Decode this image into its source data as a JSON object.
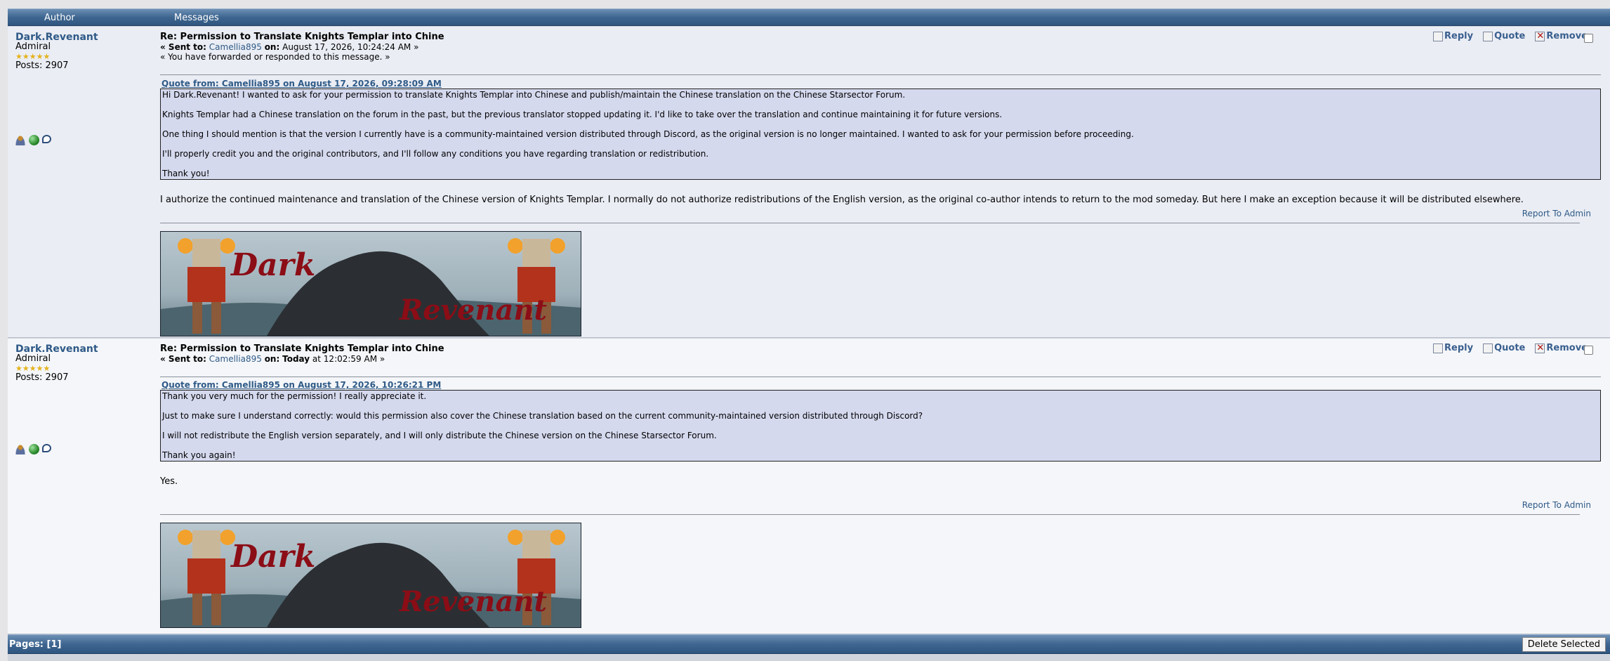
{
  "header": {
    "author_col": "Author",
    "messages_col": "Messages"
  },
  "posts": [
    {
      "author": {
        "name": "Dark.Revenant",
        "rank": "Admiral",
        "stars": "★★★★★",
        "posts": "Posts: 2907"
      },
      "subject": "Re: Permission to Translate Knights Templar into Chine",
      "sent_to_label": "« Sent to:",
      "sent_to_user": "Camellia895",
      "on_label": "on:",
      "date": "August 17, 2026, 10:24:24 AM »",
      "note": "« You have forwarded or responded to this message. »",
      "actions": {
        "reply": "Reply",
        "quote": "Quote",
        "remove": "Remove"
      },
      "quote_header": "Quote from: Camellia895 on August 17, 2026, 09:28:09 AM",
      "quote_lines": [
        "Hi Dark.Revenant! I wanted to ask for your permission to translate Knights Templar into Chinese and publish/maintain the Chinese translation on the Chinese Starsector Forum.",
        "Knights Templar had a Chinese translation on the forum in the past, but the previous translator stopped updating it. I'd like to take over the translation and continue maintaining it for future versions.",
        "One thing I should mention is that the version I currently have is a community-maintained version distributed through Discord, as the original version is no longer maintained. I wanted to ask for your permission before proceeding.",
        "I'll properly credit you and the original contributors, and I'll follow any conditions you have regarding translation or redistribution.",
        "Thank you!"
      ],
      "body": "I authorize the continued maintenance and translation of the Chinese version of Knights Templar.  I normally do not authorize redistributions of the English version, as the original co-author intends to return to the mod someday.  But here I make an exception because it will be distributed elsewhere.",
      "report": "Report To Admin",
      "signature": {
        "word1": "Dark",
        "word2": "Revenant"
      }
    },
    {
      "author": {
        "name": "Dark.Revenant",
        "rank": "Admiral",
        "stars": "★★★★★",
        "posts": "Posts: 2907"
      },
      "subject": "Re: Permission to Translate Knights Templar into Chine",
      "sent_to_label": "« Sent to:",
      "sent_to_user": "Camellia895",
      "on_label": "on:",
      "date_bold": "Today",
      "date": "at 12:02:59 AM »",
      "actions": {
        "reply": "Reply",
        "quote": "Quote",
        "remove": "Remove"
      },
      "quote_header": "Quote from: Camellia895 on August 17, 2026, 10:26:21 PM",
      "quote_lines": [
        "Thank you very much for the permission! I really appreciate it.",
        "Just to make sure I understand correctly: would this permission also cover the Chinese translation based on the current community-maintained version distributed through Discord?",
        "I will not redistribute the English version separately, and I will only distribute the Chinese version on the Chinese Starsector Forum.",
        "Thank you again!"
      ],
      "body": "Yes.",
      "report": "Report To Admin",
      "signature": {
        "word1": "Dark",
        "word2": "Revenant"
      }
    }
  ],
  "footer": {
    "pages": "Pages: [1]",
    "delete_selected": "Delete Selected"
  },
  "colors": {
    "header_bar": "#3e6690",
    "link": "#2f5a87",
    "quote_bg": "#d5d9ee",
    "signature_text": "#8b0d16"
  }
}
